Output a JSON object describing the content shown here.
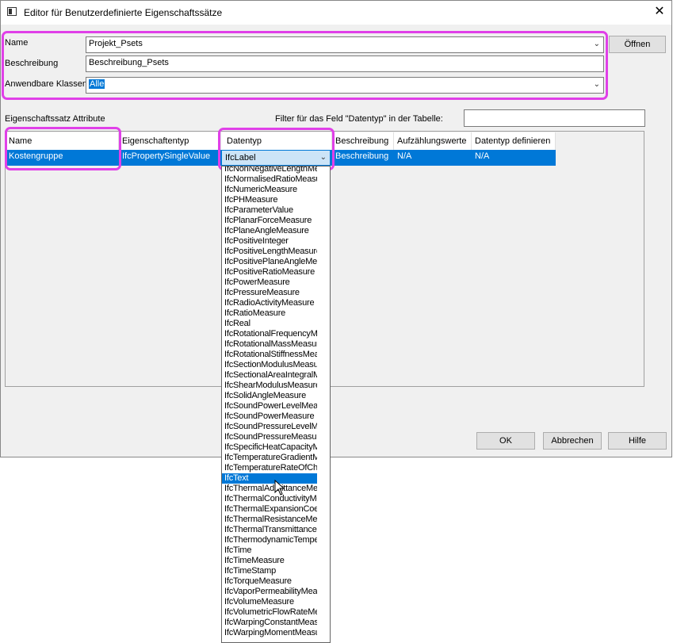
{
  "window": {
    "title": "Editor für Benutzerdefinierte Eigenschaftssätze",
    "close_glyph": "✕"
  },
  "form": {
    "name_label": "Name",
    "name_value": "Projekt_Psets",
    "open_button": "Öffnen",
    "description_label": "Beschreibung",
    "description_value": "Beschreibung_Psets",
    "classes_label": "Anwendbare Klassen",
    "classes_value": "Alle"
  },
  "attributes": {
    "section_label": "Eigenschaftssatz Attribute",
    "filter_label": "Filter für das Feld \"Datentyp\" in der Tabelle:",
    "filter_value": "",
    "columns": [
      "Name",
      "Eigenschaftentyp",
      "Datentyp",
      "Beschreibung",
      "Aufzählungswerte",
      "Datentyp definieren"
    ],
    "row": {
      "name": "Kostengruppe",
      "property_type": "IfcPropertySingleValue",
      "datatype": "IfcLabel",
      "description": "Beschreibung",
      "enum_values": "N/A",
      "datatype_define": "N/A"
    }
  },
  "dropdown": {
    "selected": "IfcText",
    "items": [
      "IfcNonNegativeLengthMeasure",
      "IfcNormalisedRatioMeasure",
      "IfcNumericMeasure",
      "IfcPHMeasure",
      "IfcParameterValue",
      "IfcPlanarForceMeasure",
      "IfcPlaneAngleMeasure",
      "IfcPositiveInteger",
      "IfcPositiveLengthMeasure",
      "IfcPositivePlaneAngleMeasure",
      "IfcPositiveRatioMeasure",
      "IfcPowerMeasure",
      "IfcPressureMeasure",
      "IfcRadioActivityMeasure",
      "IfcRatioMeasure",
      "IfcReal",
      "IfcRotationalFrequencyMeasure",
      "IfcRotationalMassMeasure",
      "IfcRotationalStiffnessMeasure",
      "IfcSectionModulusMeasure",
      "IfcSectionalAreaIntegralMeasure",
      "IfcShearModulusMeasure",
      "IfcSolidAngleMeasure",
      "IfcSoundPowerLevelMeasure",
      "IfcSoundPowerMeasure",
      "IfcSoundPressureLevelMeasure",
      "IfcSoundPressureMeasure",
      "IfcSpecificHeatCapacityMeasure",
      "IfcTemperatureGradientMeasure",
      "IfcTemperatureRateOfChangeMeasure",
      "IfcText",
      "IfcThermalAdmittanceMeasure",
      "IfcThermalConductivityMeasure",
      "IfcThermalExpansionCoefficientMeasure",
      "IfcThermalResistanceMeasure",
      "IfcThermalTransmittanceMeasure",
      "IfcThermodynamicTemperatureMeasure",
      "IfcTime",
      "IfcTimeMeasure",
      "IfcTimeStamp",
      "IfcTorqueMeasure",
      "IfcVaporPermeabilityMeasure",
      "IfcVolumeMeasure",
      "IfcVolumetricFlowRateMeasure",
      "IfcWarpingConstantMeasure",
      "IfcWarpingMomentMeasure"
    ]
  },
  "buttons": {
    "ok": "OK",
    "cancel": "Abbrechen",
    "help": "Hilfe"
  },
  "colors": {
    "highlight": "#e040e8",
    "selection": "#0078d7"
  }
}
